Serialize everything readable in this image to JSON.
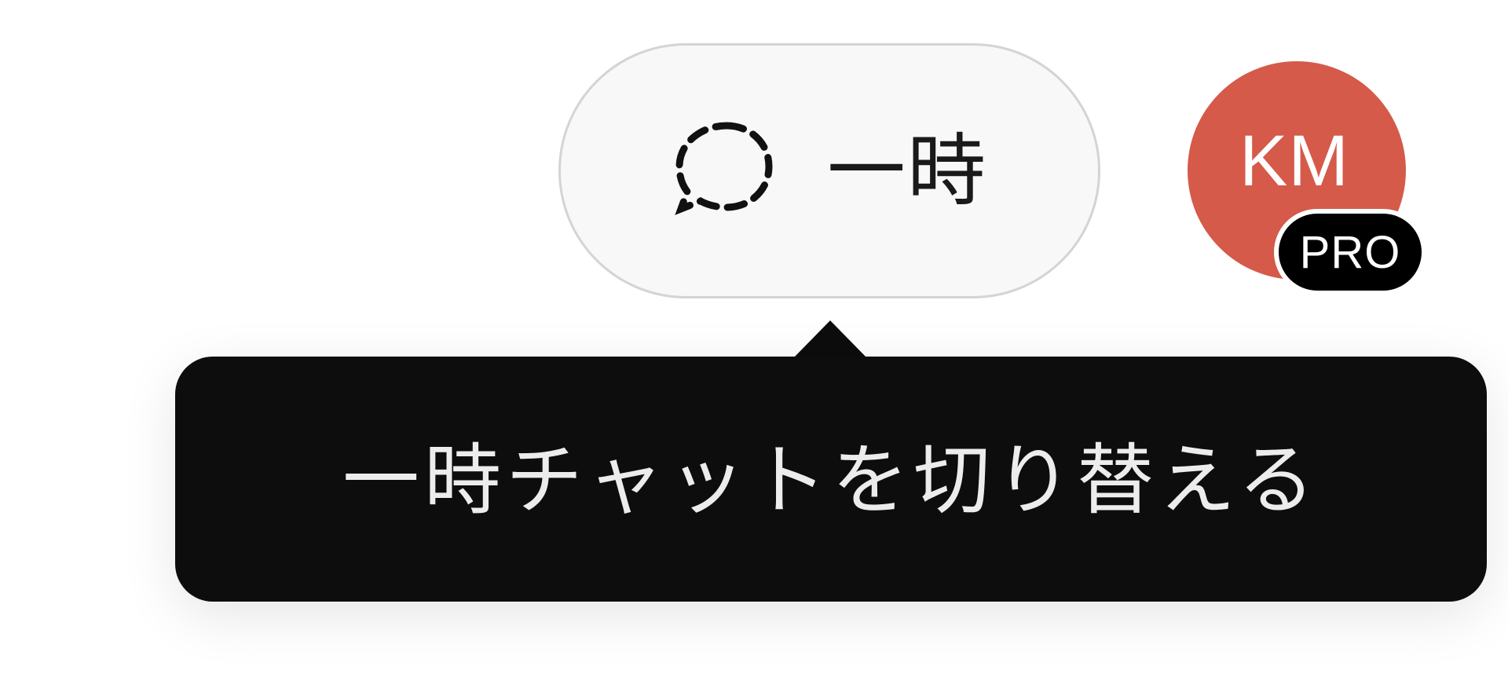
{
  "header": {
    "temporary_chat": {
      "label": "一時",
      "icon": "dashed-chat-bubble-icon"
    },
    "avatar": {
      "initials": "KM",
      "badge": "PRO",
      "color": "#d55a49"
    }
  },
  "tooltip": {
    "text": "一時チャットを切り替える"
  }
}
